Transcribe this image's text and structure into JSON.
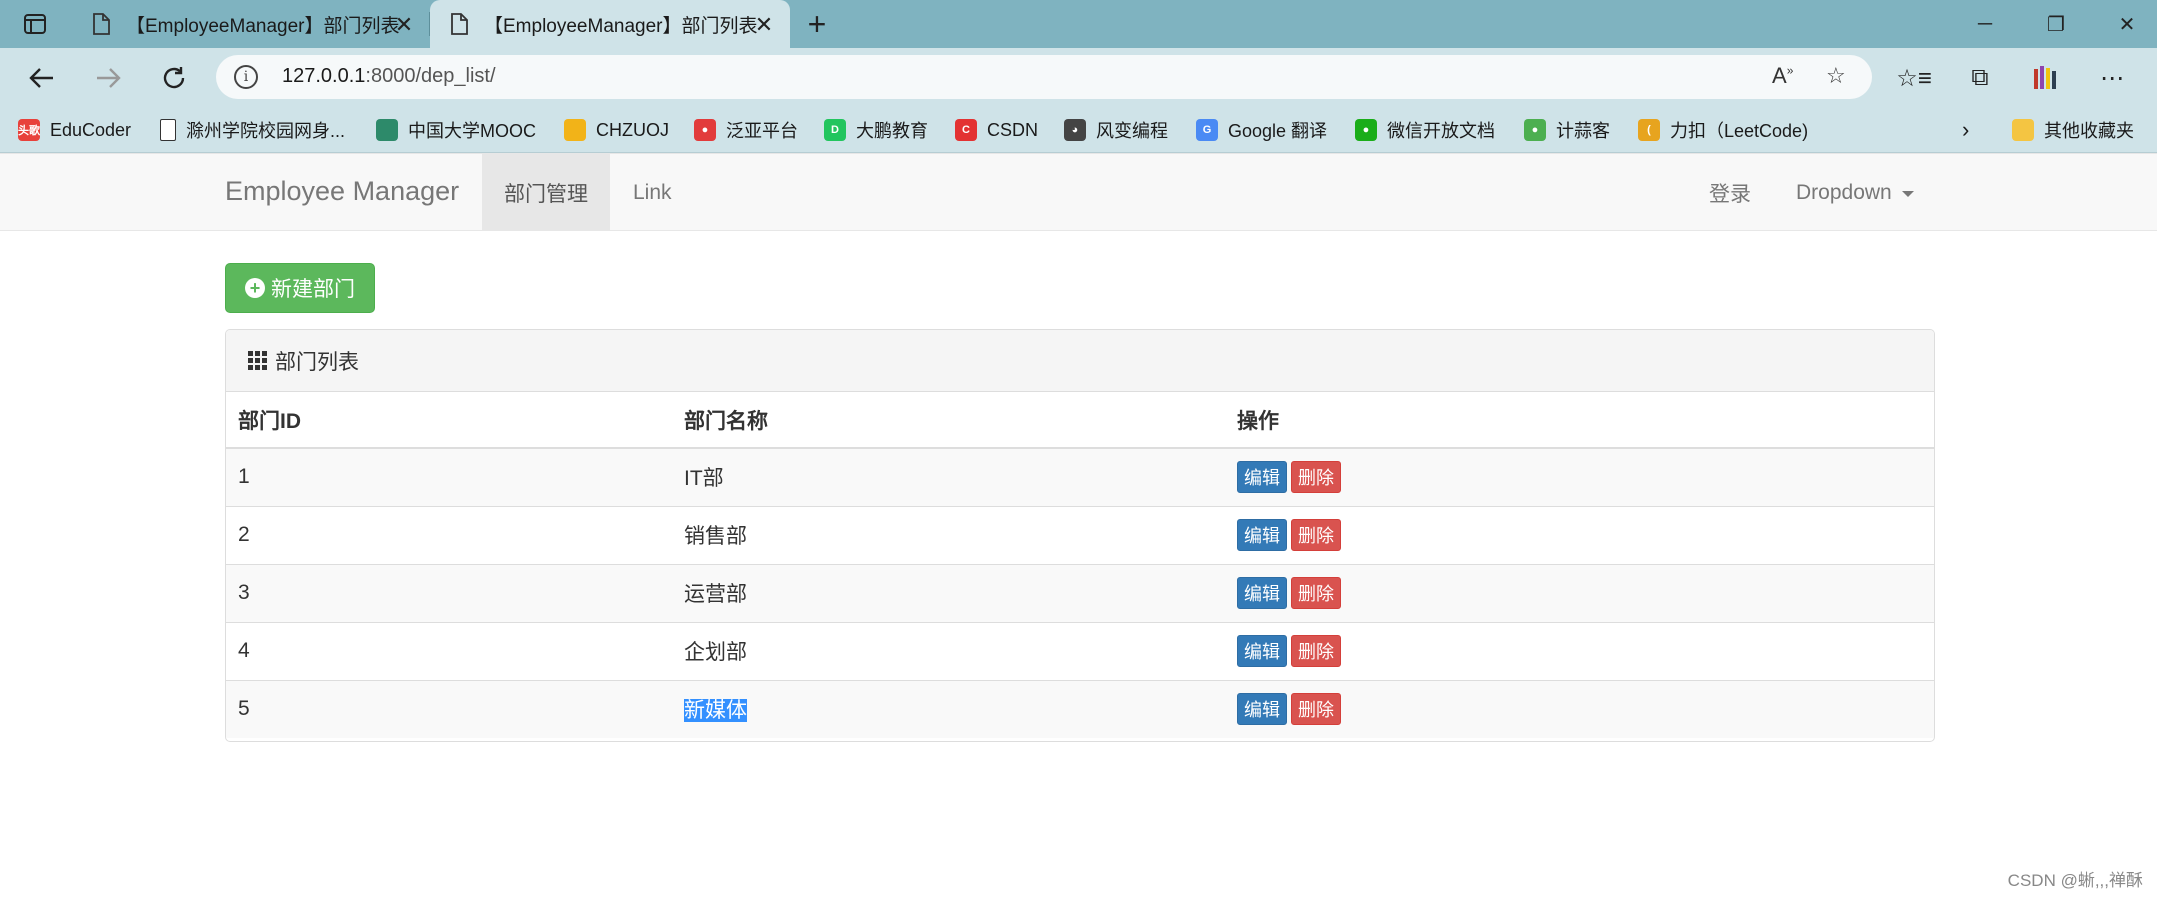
{
  "browser": {
    "tabs": [
      {
        "title": "【EmployeeManager】部门列表",
        "active": false
      },
      {
        "title": "【EmployeeManager】部门列表",
        "active": true
      }
    ],
    "url_host": "127.0.0.1",
    "url_rest": ":8000/dep_list/",
    "bookmarks": [
      {
        "label": "EduCoder",
        "icon": "educoder-icon",
        "color": "#e8413b",
        "glyph": "头歌"
      },
      {
        "label": "滁州学院校园网身...",
        "icon": "page-icon",
        "color": "#ffffff",
        "glyph": ""
      },
      {
        "label": "中国大学MOOC",
        "icon": "mooc-icon",
        "color": "#2d8a6a",
        "glyph": ""
      },
      {
        "label": "CHZUOJ",
        "icon": "chzuoj-icon",
        "color": "#f2b318",
        "glyph": ""
      },
      {
        "label": "泛亚平台",
        "icon": "fanya-icon",
        "color": "#e23b3b",
        "glyph": "●"
      },
      {
        "label": "大鹏教育",
        "icon": "dapeng-icon",
        "color": "#22c55e",
        "glyph": "D"
      },
      {
        "label": "CSDN",
        "icon": "csdn-icon",
        "color": "#e33232",
        "glyph": "C"
      },
      {
        "label": "风变编程",
        "icon": "fengbian-icon",
        "color": "#444444",
        "glyph": "◕"
      },
      {
        "label": "Google 翻译",
        "icon": "google-translate-icon",
        "color": "#4a8af4",
        "glyph": "G"
      },
      {
        "label": "微信开放文档",
        "icon": "wechat-icon",
        "color": "#1aad19",
        "glyph": "●"
      },
      {
        "label": "计蒜客",
        "icon": "jisuanke-icon",
        "color": "#4caf50",
        "glyph": "●"
      },
      {
        "label": "力扣（LeetCode)",
        "icon": "leetcode-icon",
        "color": "#e7a41f",
        "glyph": "("
      }
    ],
    "other_bookmarks": "其他收藏夹"
  },
  "navbar": {
    "brand": "Employee Manager",
    "items": [
      {
        "label": "部门管理",
        "active": true
      },
      {
        "label": "Link",
        "active": false
      }
    ],
    "login": "登录",
    "dropdown": "Dropdown"
  },
  "new_button": "新建部门",
  "panel": {
    "title": "部门列表",
    "columns": [
      "部门ID",
      "部门名称",
      "操作"
    ],
    "rows": [
      {
        "id": "1",
        "name": "IT部"
      },
      {
        "id": "2",
        "name": "销售部"
      },
      {
        "id": "3",
        "name": "运营部"
      },
      {
        "id": "4",
        "name": "企划部"
      },
      {
        "id": "5",
        "name": "新媒体"
      }
    ],
    "edit_label": "编辑",
    "delete_label": "删除"
  },
  "watermark": "CSDN @蜥,,,禅酥"
}
